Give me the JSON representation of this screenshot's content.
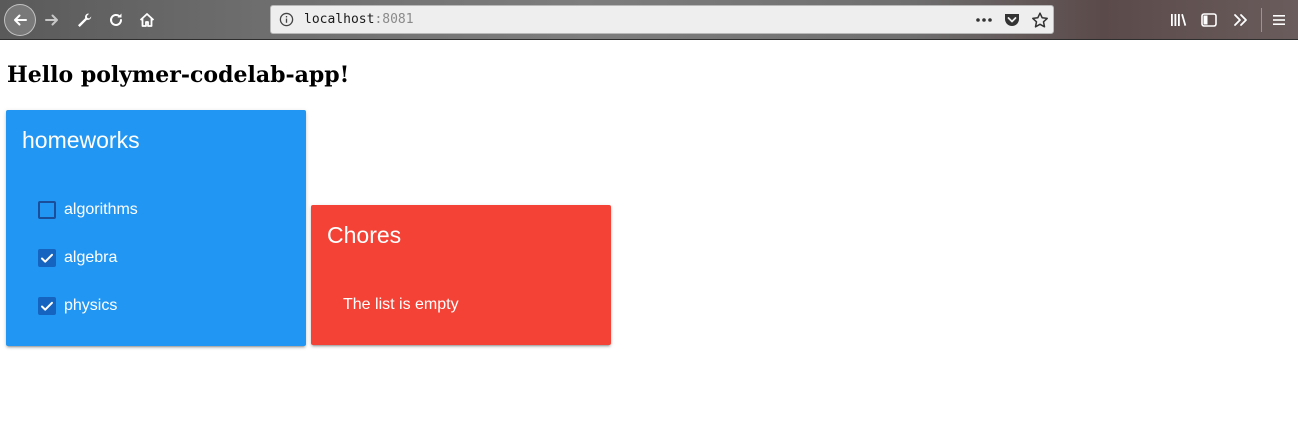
{
  "browser": {
    "url_host": "localhost",
    "url_port": ":8081",
    "icons": {
      "back": "back-arrow-icon",
      "forward": "forward-arrow-icon",
      "tools": "wrench-icon",
      "reload": "reload-icon",
      "home": "home-icon",
      "info": "info-icon",
      "page_actions": "more-dots-icon",
      "pocket": "pocket-icon",
      "bookmark": "star-icon",
      "library": "library-icon",
      "sidebar": "sidebar-icon",
      "overflow": "double-chevron-icon",
      "menu": "hamburger-menu-icon"
    }
  },
  "page": {
    "title": "Hello polymer-codelab-app!"
  },
  "lists": [
    {
      "title": "homeworks",
      "color": "#2196f3",
      "items": [
        {
          "label": "algorithms",
          "checked": false
        },
        {
          "label": "algebra",
          "checked": true
        },
        {
          "label": "physics",
          "checked": true
        }
      ]
    },
    {
      "title": "Chores",
      "color": "#f44336",
      "empty_message": "The list is empty"
    }
  ]
}
